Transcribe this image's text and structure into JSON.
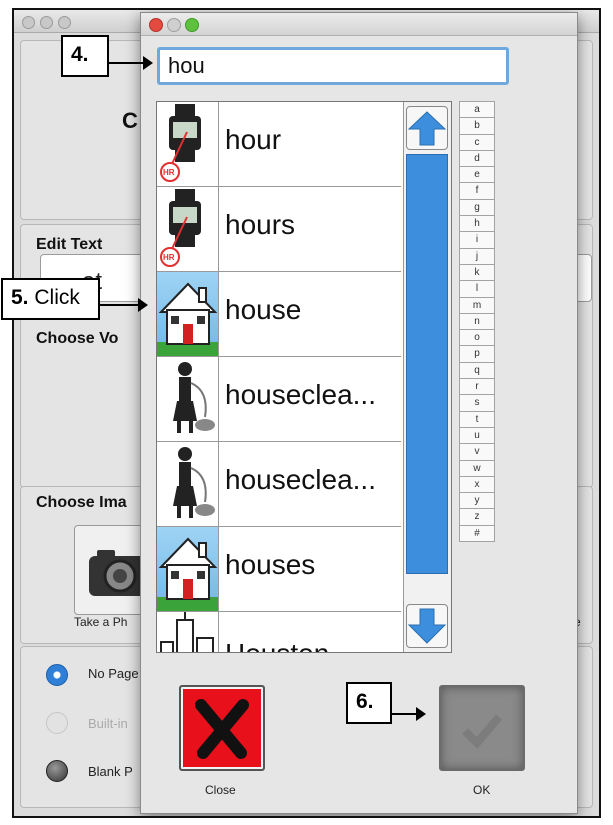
{
  "background_window": {
    "title_fragment": "C",
    "edit_text_label": "Edit Text",
    "edit_text_value_fragment": "at",
    "choose_voice_label": "Choose Vo",
    "choose_image_label": "Choose Ima",
    "take_photo_label": "Take a Ph",
    "right_fragment": "e",
    "radio_options": [
      {
        "label": "No Page",
        "state": "selected"
      },
      {
        "label": "Built-in",
        "state": "disabled"
      },
      {
        "label": "Blank P",
        "state": "unselected"
      }
    ]
  },
  "dialog": {
    "search_value": "hou",
    "results": [
      {
        "label": "hour",
        "icon": "watch-hour-icon"
      },
      {
        "label": "hours",
        "icon": "watch-hour-icon"
      },
      {
        "label": "house",
        "icon": "house-icon"
      },
      {
        "label": "houseclea...",
        "icon": "cleaner-vacuum-icon"
      },
      {
        "label": "houseclea...",
        "icon": "cleaner-vacuum-icon"
      },
      {
        "label": "houses",
        "icon": "house-icon"
      },
      {
        "label": "Houston",
        "icon": "city-skyline-icon"
      }
    ],
    "watch_badge": "HR",
    "alphabet": [
      "a",
      "b",
      "c",
      "d",
      "e",
      "f",
      "g",
      "h",
      "i",
      "j",
      "k",
      "l",
      "m",
      "n",
      "o",
      "p",
      "q",
      "r",
      "s",
      "t",
      "u",
      "v",
      "w",
      "x",
      "y",
      "z",
      "#"
    ],
    "close_label": "Close",
    "ok_label": "OK",
    "accent_color": "#3d8fdd",
    "close_color": "#e8101a"
  },
  "callouts": {
    "step4": "4.",
    "step5_num": "5.",
    "step5_text": "Click",
    "step6": "6."
  }
}
